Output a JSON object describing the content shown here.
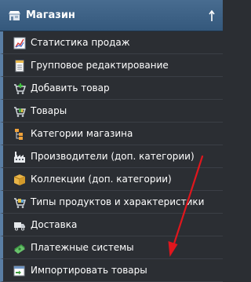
{
  "section": {
    "title": "Магазин",
    "icon": "shop-icon",
    "toggle_icon": "arrow-up-icon"
  },
  "menu": {
    "items": [
      {
        "label": "Статистика продаж",
        "icon": "chart-icon"
      },
      {
        "label": "Групповое редактирование",
        "icon": "spreadsheet-icon"
      },
      {
        "label": "Добавить товар",
        "icon": "add-to-cart-icon"
      },
      {
        "label": "Товары",
        "icon": "cart-icon"
      },
      {
        "label": "Категории магазина",
        "icon": "categories-icon"
      },
      {
        "label": "Производители (доп. категории)",
        "icon": "factory-icon"
      },
      {
        "label": "Коллекции (доп. категории)",
        "icon": "box-icon"
      },
      {
        "label": "Типы продуктов и характеристики",
        "icon": "product-types-icon"
      },
      {
        "label": "Доставка",
        "icon": "truck-icon"
      },
      {
        "label": "Платежные системы",
        "icon": "money-icon"
      },
      {
        "label": "Импортировать товары",
        "icon": "import-icon"
      }
    ]
  },
  "colors": {
    "header_bg": "#3d6186",
    "menu_bg": "#2b2e33",
    "accent_border": "#5a7ea4",
    "annotation_arrow": "#e0161d"
  }
}
